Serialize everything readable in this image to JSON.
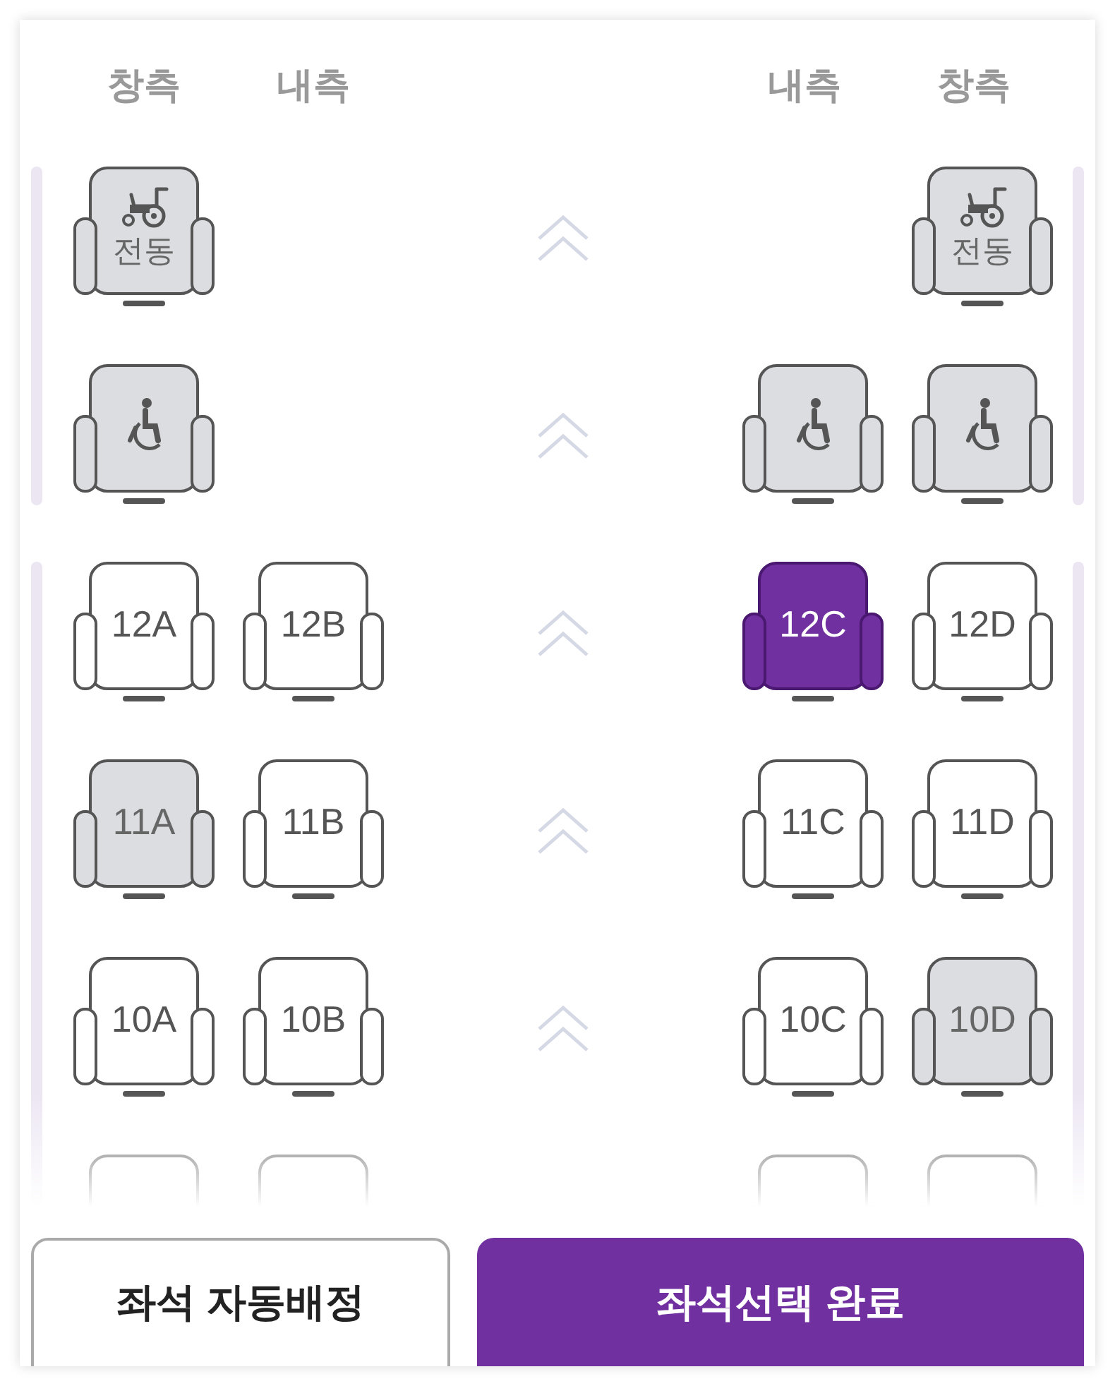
{
  "headers": [
    "창측",
    "내측",
    "내측",
    "창측"
  ],
  "sections": [
    {
      "rows": [
        {
          "seats": [
            {
              "kind": "power_wheelchair",
              "label": "전동",
              "occupied": true,
              "selected": false
            },
            {
              "kind": "empty"
            },
            {
              "kind": "empty"
            },
            {
              "kind": "power_wheelchair",
              "label": "전동",
              "occupied": true,
              "selected": false
            }
          ]
        },
        {
          "seats": [
            {
              "kind": "wheelchair",
              "occupied": true,
              "selected": false
            },
            {
              "kind": "empty"
            },
            {
              "kind": "wheelchair",
              "occupied": true,
              "selected": false
            },
            {
              "kind": "wheelchair",
              "occupied": true,
              "selected": false
            }
          ]
        }
      ]
    },
    {
      "rows": [
        {
          "seats": [
            {
              "kind": "seat",
              "label": "12A",
              "occupied": false,
              "selected": false
            },
            {
              "kind": "seat",
              "label": "12B",
              "occupied": false,
              "selected": false
            },
            {
              "kind": "seat",
              "label": "12C",
              "selected": true
            },
            {
              "kind": "seat",
              "label": "12D",
              "occupied": false,
              "selected": false
            }
          ]
        },
        {
          "seats": [
            {
              "kind": "seat",
              "label": "11A",
              "occupied": true,
              "selected": false
            },
            {
              "kind": "seat",
              "label": "11B",
              "occupied": false,
              "selected": false
            },
            {
              "kind": "seat",
              "label": "11C",
              "occupied": false,
              "selected": false
            },
            {
              "kind": "seat",
              "label": "11D",
              "occupied": false,
              "selected": false
            }
          ]
        },
        {
          "seats": [
            {
              "kind": "seat",
              "label": "10A",
              "occupied": false,
              "selected": false
            },
            {
              "kind": "seat",
              "label": "10B",
              "occupied": false,
              "selected": false
            },
            {
              "kind": "seat",
              "label": "10C",
              "occupied": false,
              "selected": false
            },
            {
              "kind": "seat",
              "label": "10D",
              "occupied": true,
              "selected": false
            }
          ]
        },
        {
          "seats": [
            {
              "kind": "seat",
              "occupied": false,
              "selected": false
            },
            {
              "kind": "seat",
              "occupied": false,
              "selected": false
            },
            {
              "kind": "seat",
              "occupied": false,
              "selected": false
            },
            {
              "kind": "seat",
              "occupied": false,
              "selected": false
            }
          ]
        }
      ]
    }
  ],
  "buttons": [
    {
      "label": "좌석 자동배정",
      "primary": false
    },
    {
      "label": "좌석선택 완료",
      "primary": true
    }
  ]
}
